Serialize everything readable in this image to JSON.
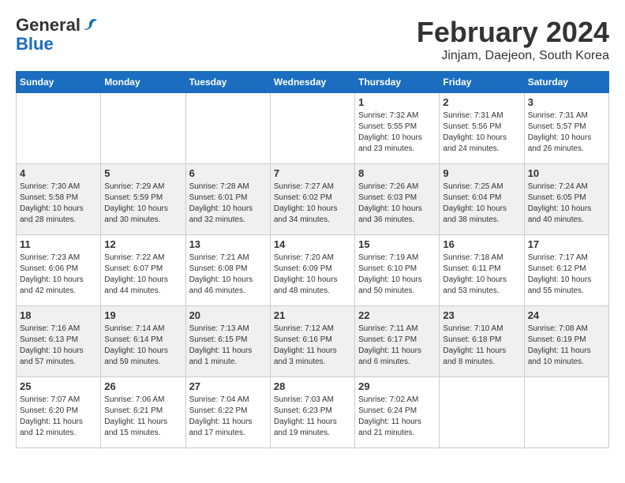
{
  "header": {
    "logo_general": "General",
    "logo_blue": "Blue",
    "month_title": "February 2024",
    "location": "Jinjam, Daejeon, South Korea"
  },
  "days_of_week": [
    "Sunday",
    "Monday",
    "Tuesday",
    "Wednesday",
    "Thursday",
    "Friday",
    "Saturday"
  ],
  "weeks": [
    {
      "days": [
        {
          "number": "",
          "detail": ""
        },
        {
          "number": "",
          "detail": ""
        },
        {
          "number": "",
          "detail": ""
        },
        {
          "number": "",
          "detail": ""
        },
        {
          "number": "1",
          "detail": "Sunrise: 7:32 AM\nSunset: 5:55 PM\nDaylight: 10 hours\nand 23 minutes."
        },
        {
          "number": "2",
          "detail": "Sunrise: 7:31 AM\nSunset: 5:56 PM\nDaylight: 10 hours\nand 24 minutes."
        },
        {
          "number": "3",
          "detail": "Sunrise: 7:31 AM\nSunset: 5:57 PM\nDaylight: 10 hours\nand 26 minutes."
        }
      ]
    },
    {
      "days": [
        {
          "number": "4",
          "detail": "Sunrise: 7:30 AM\nSunset: 5:58 PM\nDaylight: 10 hours\nand 28 minutes."
        },
        {
          "number": "5",
          "detail": "Sunrise: 7:29 AM\nSunset: 5:59 PM\nDaylight: 10 hours\nand 30 minutes."
        },
        {
          "number": "6",
          "detail": "Sunrise: 7:28 AM\nSunset: 6:01 PM\nDaylight: 10 hours\nand 32 minutes."
        },
        {
          "number": "7",
          "detail": "Sunrise: 7:27 AM\nSunset: 6:02 PM\nDaylight: 10 hours\nand 34 minutes."
        },
        {
          "number": "8",
          "detail": "Sunrise: 7:26 AM\nSunset: 6:03 PM\nDaylight: 10 hours\nand 36 minutes."
        },
        {
          "number": "9",
          "detail": "Sunrise: 7:25 AM\nSunset: 6:04 PM\nDaylight: 10 hours\nand 38 minutes."
        },
        {
          "number": "10",
          "detail": "Sunrise: 7:24 AM\nSunset: 6:05 PM\nDaylight: 10 hours\nand 40 minutes."
        }
      ]
    },
    {
      "days": [
        {
          "number": "11",
          "detail": "Sunrise: 7:23 AM\nSunset: 6:06 PM\nDaylight: 10 hours\nand 42 minutes."
        },
        {
          "number": "12",
          "detail": "Sunrise: 7:22 AM\nSunset: 6:07 PM\nDaylight: 10 hours\nand 44 minutes."
        },
        {
          "number": "13",
          "detail": "Sunrise: 7:21 AM\nSunset: 6:08 PM\nDaylight: 10 hours\nand 46 minutes."
        },
        {
          "number": "14",
          "detail": "Sunrise: 7:20 AM\nSunset: 6:09 PM\nDaylight: 10 hours\nand 48 minutes."
        },
        {
          "number": "15",
          "detail": "Sunrise: 7:19 AM\nSunset: 6:10 PM\nDaylight: 10 hours\nand 50 minutes."
        },
        {
          "number": "16",
          "detail": "Sunrise: 7:18 AM\nSunset: 6:11 PM\nDaylight: 10 hours\nand 53 minutes."
        },
        {
          "number": "17",
          "detail": "Sunrise: 7:17 AM\nSunset: 6:12 PM\nDaylight: 10 hours\nand 55 minutes."
        }
      ]
    },
    {
      "days": [
        {
          "number": "18",
          "detail": "Sunrise: 7:16 AM\nSunset: 6:13 PM\nDaylight: 10 hours\nand 57 minutes."
        },
        {
          "number": "19",
          "detail": "Sunrise: 7:14 AM\nSunset: 6:14 PM\nDaylight: 10 hours\nand 59 minutes."
        },
        {
          "number": "20",
          "detail": "Sunrise: 7:13 AM\nSunset: 6:15 PM\nDaylight: 11 hours\nand 1 minute."
        },
        {
          "number": "21",
          "detail": "Sunrise: 7:12 AM\nSunset: 6:16 PM\nDaylight: 11 hours\nand 3 minutes."
        },
        {
          "number": "22",
          "detail": "Sunrise: 7:11 AM\nSunset: 6:17 PM\nDaylight: 11 hours\nand 6 minutes."
        },
        {
          "number": "23",
          "detail": "Sunrise: 7:10 AM\nSunset: 6:18 PM\nDaylight: 11 hours\nand 8 minutes."
        },
        {
          "number": "24",
          "detail": "Sunrise: 7:08 AM\nSunset: 6:19 PM\nDaylight: 11 hours\nand 10 minutes."
        }
      ]
    },
    {
      "days": [
        {
          "number": "25",
          "detail": "Sunrise: 7:07 AM\nSunset: 6:20 PM\nDaylight: 11 hours\nand 12 minutes."
        },
        {
          "number": "26",
          "detail": "Sunrise: 7:06 AM\nSunset: 6:21 PM\nDaylight: 11 hours\nand 15 minutes."
        },
        {
          "number": "27",
          "detail": "Sunrise: 7:04 AM\nSunset: 6:22 PM\nDaylight: 11 hours\nand 17 minutes."
        },
        {
          "number": "28",
          "detail": "Sunrise: 7:03 AM\nSunset: 6:23 PM\nDaylight: 11 hours\nand 19 minutes."
        },
        {
          "number": "29",
          "detail": "Sunrise: 7:02 AM\nSunset: 6:24 PM\nDaylight: 11 hours\nand 21 minutes."
        },
        {
          "number": "",
          "detail": ""
        },
        {
          "number": "",
          "detail": ""
        }
      ]
    }
  ]
}
